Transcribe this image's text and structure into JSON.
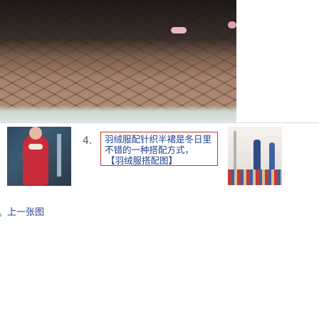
{
  "article": {
    "item": {
      "number": "4.",
      "caption_line1": "羽绒服配针织半裙是冬日里",
      "caption_line2": "不错的一种搭配方式，",
      "source": "【羽绒服搭配图】"
    },
    "footer_marker": "。",
    "footer_link": "上一张图"
  }
}
